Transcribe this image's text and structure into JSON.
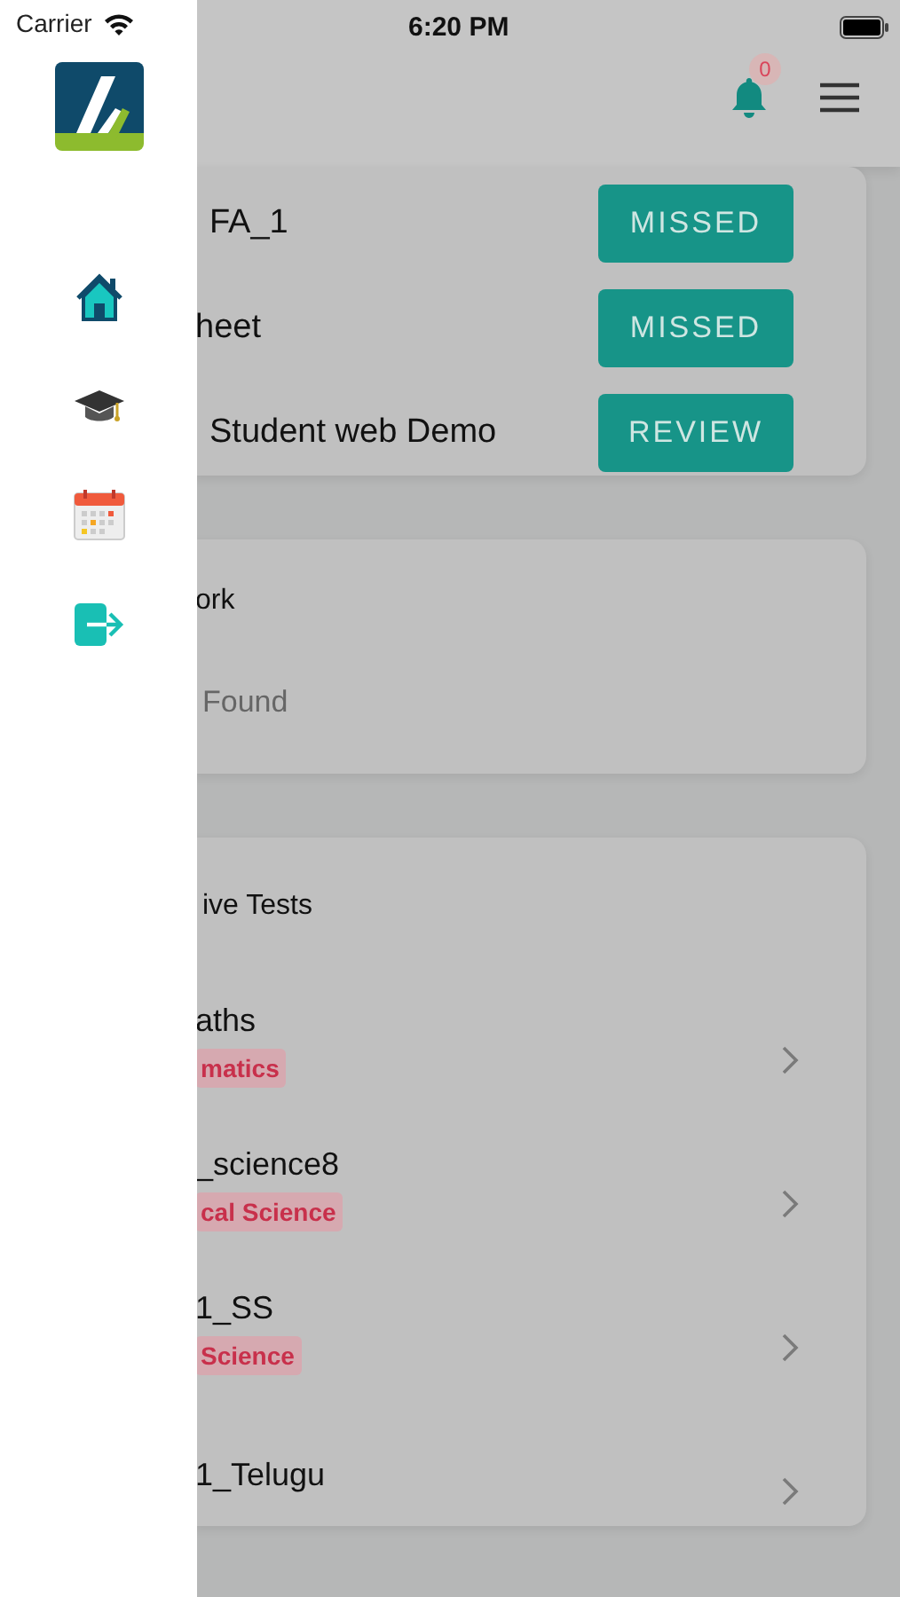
{
  "status_bar": {
    "carrier": "Carrier",
    "time": "6:20 PM"
  },
  "header": {
    "notification_count": "0"
  },
  "drawer": {
    "items": [
      {
        "kind": "home"
      },
      {
        "kind": "courses"
      },
      {
        "kind": "calendar"
      },
      {
        "kind": "logout"
      }
    ]
  },
  "assignments": [
    {
      "title": "FA_1",
      "action": "MISSED"
    },
    {
      "title": "heet",
      "action": "MISSED"
    },
    {
      "title": "Student web Demo",
      "action": "REVIEW"
    }
  ],
  "homework": {
    "title": "ork",
    "empty_message": "Found"
  },
  "tests": {
    "title": "ive Tests",
    "items": [
      {
        "title": "aths",
        "subject": "matics"
      },
      {
        "title": "_science8",
        "subject": "cal Science"
      },
      {
        "title": "1_SS",
        "subject": "Science"
      },
      {
        "title": "1_Telugu"
      }
    ]
  }
}
